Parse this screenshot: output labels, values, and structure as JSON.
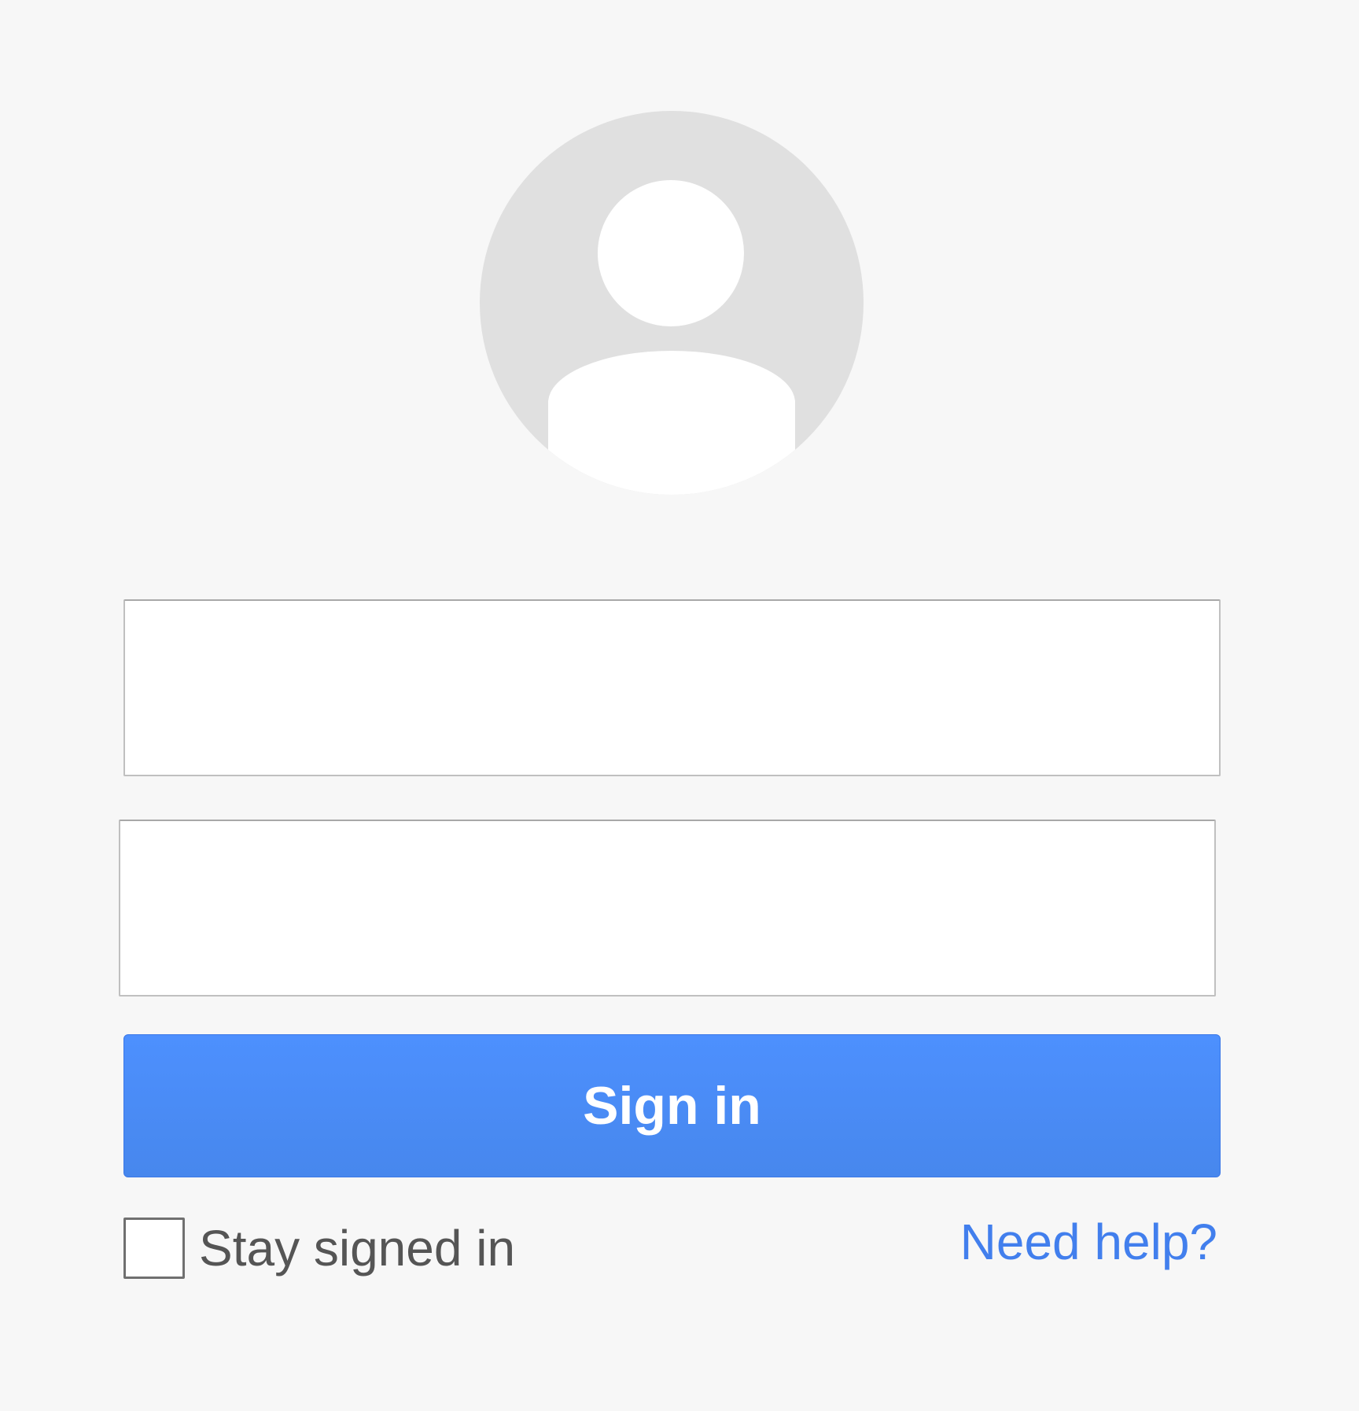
{
  "login": {
    "avatar_icon": "default-user-avatar-icon",
    "email_value": "",
    "password_value": "",
    "signin_label": "Sign in",
    "stay_signed_in_label": "Stay signed in",
    "stay_signed_in_checked": false,
    "need_help_label": "Need help?"
  },
  "colors": {
    "background": "#f7f7f7",
    "avatar_circle": "#e0e0e0",
    "button_blue": "#4d90fe",
    "link_blue": "#427fed"
  }
}
